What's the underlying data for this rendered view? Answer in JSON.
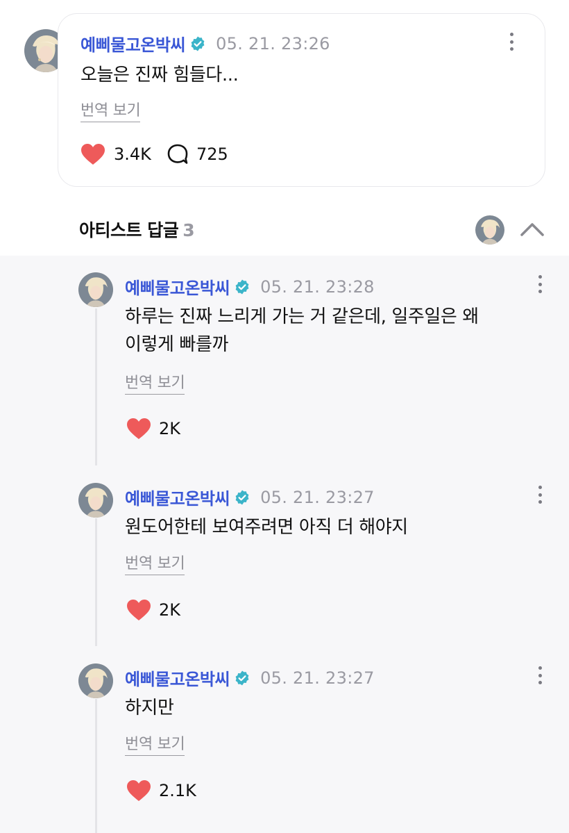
{
  "post": {
    "author": "예삐물고온박씨",
    "timestamp": "05. 21. 23:26",
    "text": "오늘은 진짜 힘들다...",
    "translate_label": "번역 보기",
    "likes": "3.4K",
    "comments": "725"
  },
  "replies_header": {
    "title": "아티스트 답글",
    "count": "3"
  },
  "replies": [
    {
      "author": "예삐물고온박씨",
      "timestamp": "05. 21. 23:28",
      "text_line1": "하루는 진짜 느리게 가는 거 같은데, 일주일은 왜",
      "text_line2": "이렇게 빠를까",
      "translate_label": "번역 보기",
      "likes": "2K"
    },
    {
      "author": "예삐물고온박씨",
      "timestamp": "05. 21. 23:27",
      "text_line1": "원도어한테 보여주려면 아직 더 해야지",
      "translate_label": "번역 보기",
      "likes": "2K"
    },
    {
      "author": "예삐물고온박씨",
      "timestamp": "05. 21. 23:27",
      "text_line1": "하지만",
      "translate_label": "번역 보기",
      "likes": "2.1K"
    }
  ],
  "colors": {
    "author_blue": "#3a57d6",
    "verified_teal": "#3bb4c9",
    "heart_red": "#ee5a5a",
    "muted_gray": "#9a9aa2",
    "reply_background": "#f7f7f9"
  },
  "icons": [
    "verified-badge-icon",
    "more-options-icon",
    "heart-icon",
    "comment-bubble-icon",
    "chevron-up-icon"
  ]
}
